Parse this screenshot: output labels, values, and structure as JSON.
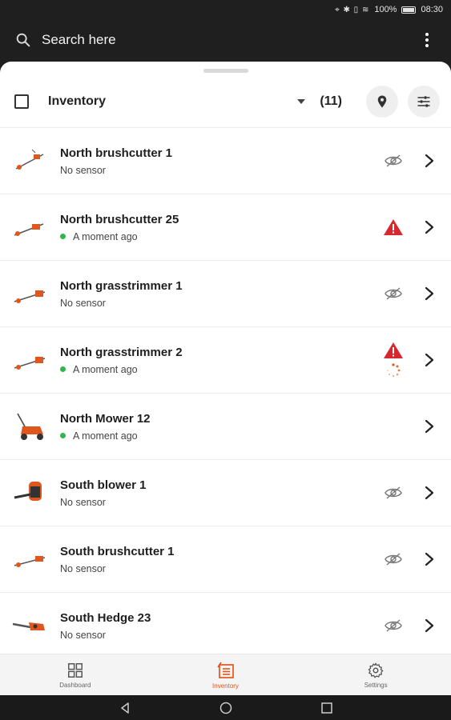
{
  "status_bar": {
    "battery": "100%",
    "time": "08:30"
  },
  "search": {
    "placeholder": "Search here"
  },
  "toolbar": {
    "title": "Inventory",
    "count": "(11)"
  },
  "items": [
    {
      "name": "North brushcutter 1",
      "status": "No sensor",
      "online": false,
      "icons": [
        "no-sensor"
      ]
    },
    {
      "name": "North brushcutter 25",
      "status": "A moment ago",
      "online": true,
      "icons": [
        "warning"
      ]
    },
    {
      "name": "North grasstrimmer 1",
      "status": "No sensor",
      "online": false,
      "icons": [
        "no-sensor"
      ]
    },
    {
      "name": "North grasstrimmer 2",
      "status": "A moment ago",
      "online": true,
      "icons": [
        "warning",
        "loading"
      ]
    },
    {
      "name": "North Mower 12",
      "status": "A moment ago",
      "online": true,
      "icons": []
    },
    {
      "name": "South blower 1",
      "status": "No sensor",
      "online": false,
      "icons": [
        "no-sensor"
      ]
    },
    {
      "name": "South brushcutter 1",
      "status": "No sensor",
      "online": false,
      "icons": [
        "no-sensor"
      ]
    },
    {
      "name": "South Hedge 23",
      "status": "No sensor",
      "online": false,
      "icons": [
        "no-sensor"
      ]
    }
  ],
  "bottom_nav": [
    {
      "label": "Dashboard",
      "icon": "grid-icon",
      "active": false
    },
    {
      "label": "Inventory",
      "icon": "inventory-icon",
      "active": true
    },
    {
      "label": "Settings",
      "icon": "gear-icon",
      "active": false
    }
  ],
  "colors": {
    "accent": "#e0561f",
    "warning": "#d7282f",
    "online": "#2db84b"
  }
}
